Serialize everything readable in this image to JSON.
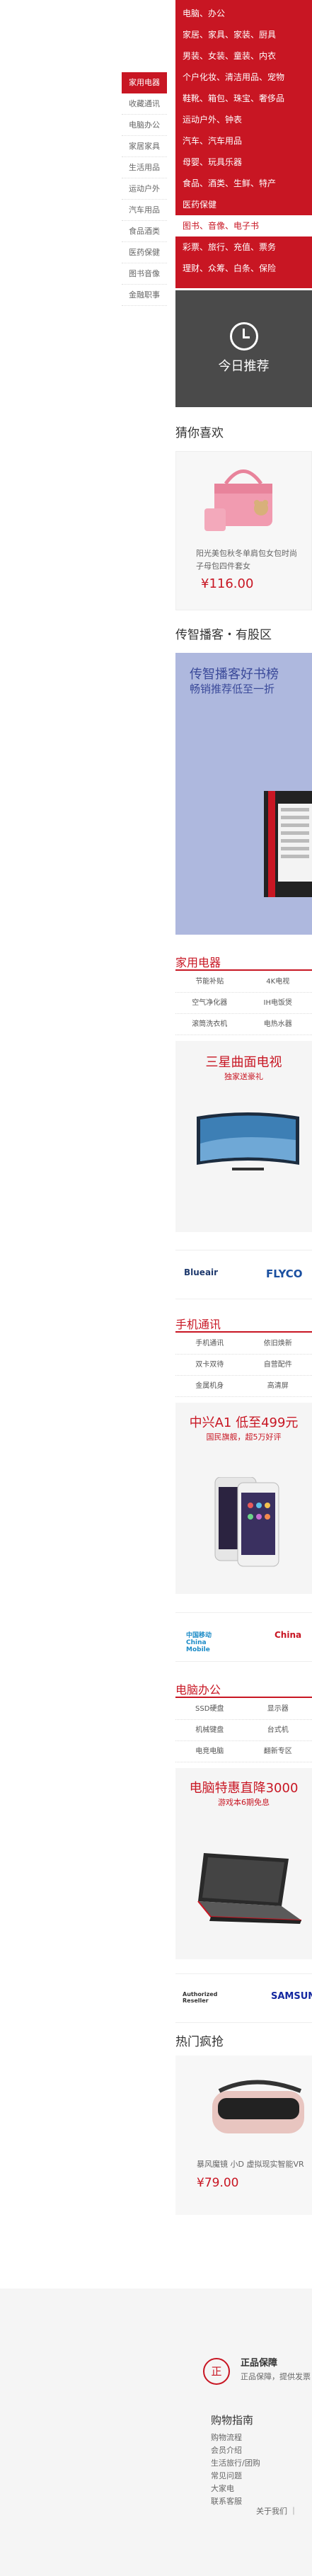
{
  "floor_nav": [
    "家用电器",
    "收藏通讯",
    "电脑办公",
    "家居家具",
    "生活用品",
    "运动户外",
    "汽车用品",
    "食品酒类",
    "医药保健",
    "图书音像",
    "金融职事"
  ],
  "categories": [
    "电脑、办公",
    "家居、家具、家装、厨具",
    "男装、女装、童装、内衣",
    "个户化妆、清洁用品、宠物",
    "鞋靴、箱包、珠宝、奢侈品",
    "运动户外、钟表",
    "汽车、汽车用品",
    "母婴、玩具乐器",
    "食品、酒类、生鲜、特产",
    "医药保健",
    "图书、音像、电子书",
    "彩票、旅行、充值、票务",
    "理财、众筹、白条、保险"
  ],
  "today_recommend": "今日推荐",
  "guess_like": {
    "title": "猜你喜欢",
    "desc": "阳光美包秋冬单肩包女包时尚子母包四件套女",
    "price": "¥116.00"
  },
  "broadcast": {
    "title": "传智播客・有股区",
    "line1": "传智播客好书榜",
    "line2": "畅销推荐低至一折"
  },
  "floor_appliance": {
    "title": "家用电器",
    "tags": [
      [
        "节能补贴",
        "4K电视"
      ],
      [
        "空气净化器",
        "IH电饭煲"
      ],
      [
        "滚筒洗衣机",
        "电热水器"
      ]
    ],
    "promo": "三星曲面电视",
    "promo_sub": "独家送豪礼"
  },
  "brand_strip_1": [
    "Blueair",
    "FLYCO"
  ],
  "floor_phone": {
    "title": "手机通讯",
    "tags": [
      [
        "手机通讯",
        "依旧焕新"
      ],
      [
        "双卡双待",
        "自营配件"
      ],
      [
        "金属机身",
        "高清屏"
      ]
    ],
    "promo": "中兴A1 低至499元",
    "promo_sub": "国民旗舰，超5万好评"
  },
  "brand_strip_2": [
    "中国移动 China Mobile",
    "China"
  ],
  "floor_computer": {
    "title": "电脑办公",
    "tags": [
      [
        "SSD硬盘",
        "显示器"
      ],
      [
        "机械键盘",
        "台式机"
      ],
      [
        "电竞电脑",
        "翻新专区"
      ]
    ],
    "promo": "电脑特惠直降3000",
    "promo_sub": "游戏本6期免息"
  },
  "brand_strip_3": [
    "Authorized Reseller",
    "SAMSUNG"
  ],
  "hot": {
    "title": "热门疯抢",
    "desc": "暴风魔镜 小D 虚拟现实智能VR",
    "price": "¥79.00"
  },
  "footer": {
    "guarantee_icon": "正",
    "guarantee_title": "正品保障",
    "guarantee_sub": "正品保障，提供发票",
    "guide_title": "购物指南",
    "guide_items": [
      "购物流程",
      "会员介绍",
      "生活旅行/团购",
      "常见问题",
      "大家电",
      "联系客服"
    ],
    "about": "关于我们 ｜"
  }
}
